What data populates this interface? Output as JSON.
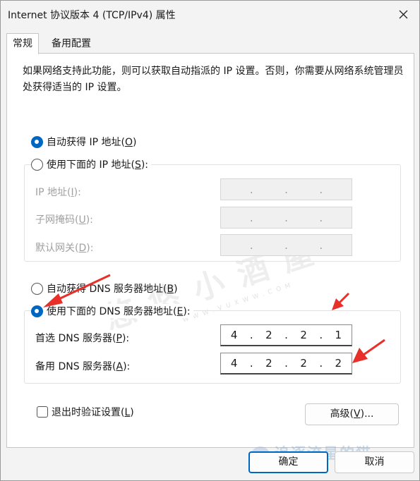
{
  "window": {
    "title": "Internet 协议版本 4 (TCP/IPv4) 属性",
    "close_glyph": "✕"
  },
  "tabs": [
    {
      "label": "常规",
      "active": true
    },
    {
      "label": "备用配置",
      "active": false
    }
  ],
  "description": "如果网络支持此功能，则可以获取自动指派的 IP 设置。否则，你需要从网络系统管理员处获得适当的 IP 设置。",
  "ip_mode": {
    "auto_label": "自动获得 IP 地址(",
    "auto_key": "O",
    "auto_close": ")",
    "auto_checked": true,
    "manual_label": "使用下面的 IP 地址(",
    "manual_key": "S",
    "manual_close": "):",
    "manual_checked": false
  },
  "ip_fields": [
    {
      "label_pre": "IP 地址(",
      "key": "I",
      "label_post": "):",
      "value": [
        "",
        "",
        "",
        ""
      ]
    },
    {
      "label_pre": "子网掩码(",
      "key": "U",
      "label_post": "):",
      "value": [
        "",
        "",
        "",
        ""
      ]
    },
    {
      "label_pre": "默认网关(",
      "key": "D",
      "label_post": "):",
      "value": [
        "",
        "",
        "",
        ""
      ]
    }
  ],
  "dns_mode": {
    "auto_label": "自动获得 DNS 服务器地址(",
    "auto_key": "B",
    "auto_close": ")",
    "auto_checked": false,
    "manual_label": "使用下面的 DNS 服务器地址(",
    "manual_key": "E",
    "manual_close": "):",
    "manual_checked": true
  },
  "dns_fields": [
    {
      "label_pre": "首选 DNS 服务器(",
      "key": "P",
      "label_post": "):",
      "value": [
        "4",
        "2",
        "2",
        "1"
      ]
    },
    {
      "label_pre": "备用 DNS 服务器(",
      "key": "A",
      "label_post": "):",
      "value": [
        "4",
        "2",
        "2",
        "2"
      ]
    }
  ],
  "validate_on_exit": {
    "label_pre": "退出时验证设置(",
    "key": "L",
    "label_post": ")",
    "checked": false
  },
  "buttons": {
    "advanced_pre": "高级(",
    "advanced_key": "V",
    "advanced_post": ")...",
    "ok": "确定",
    "cancel": "取消"
  },
  "watermarks": {
    "center": "悠悠小酒屋",
    "center_url": "WWW.VUXWW.COM",
    "corner": "追逐流星的猫"
  },
  "colors": {
    "accent": "#0067c0",
    "annotation_arrow": "#e8302a"
  }
}
